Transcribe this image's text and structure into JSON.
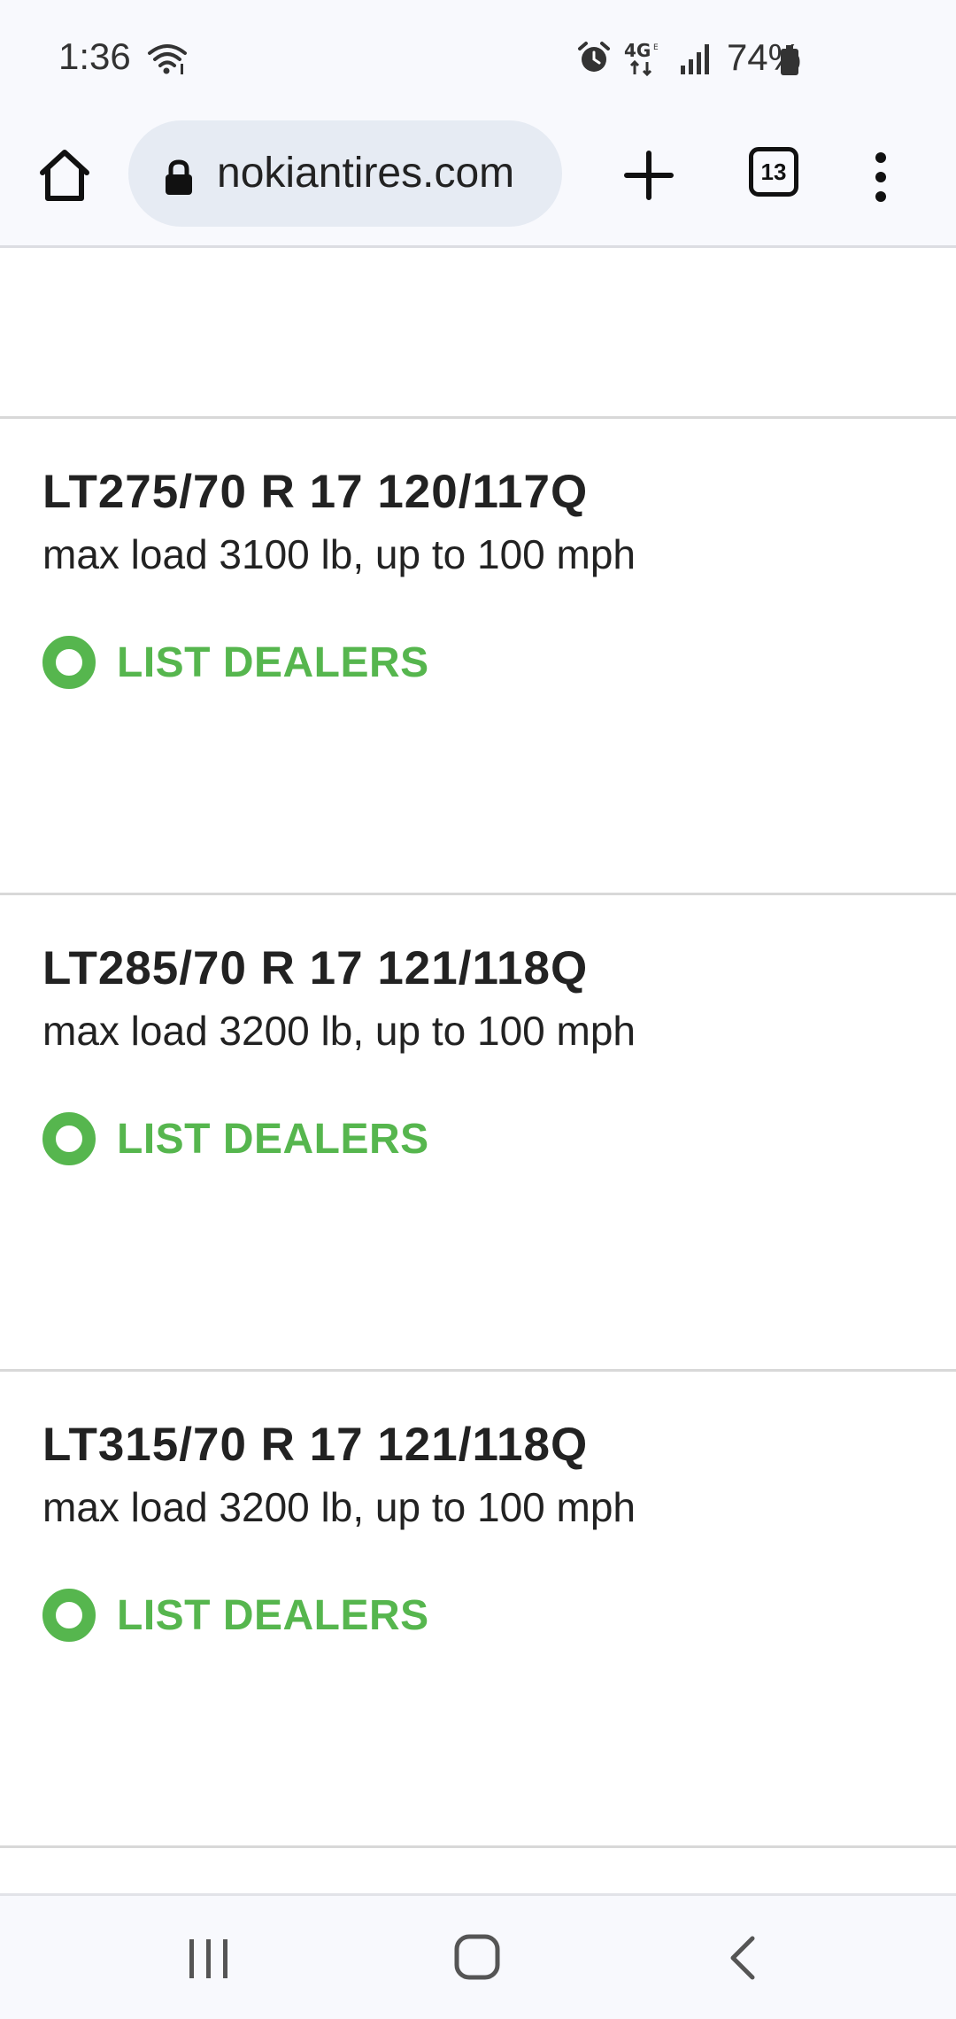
{
  "status_bar": {
    "time": "1:36",
    "battery_percent": "74%",
    "icons": [
      "wifi-icon",
      "alarm-icon",
      "4g-lte-icon",
      "signal-icon",
      "battery-icon"
    ]
  },
  "browser": {
    "url": "nokiantires.com",
    "tab_count": "13",
    "icons": [
      "home-icon",
      "lock-icon",
      "plus-icon",
      "tabs-icon",
      "more-vertical-icon"
    ]
  },
  "tires": [
    {
      "size": "LT275/70 R 17 120/117Q",
      "spec": "max load 3100 lb, up to 100 mph",
      "action": "LIST DEALERS"
    },
    {
      "size": "LT285/70 R 17 121/118Q",
      "spec": "max load 3200 lb, up to 100 mph",
      "action": "LIST DEALERS"
    },
    {
      "size": "LT315/70 R 17 121/118Q",
      "spec": "max load 3200 lb, up to 100 mph",
      "action": "LIST DEALERS"
    }
  ],
  "colors": {
    "accent_green": "#56b64e",
    "text_dark": "#222222",
    "chrome_bg": "#f8f9fd",
    "url_pill_bg": "#e6ebf3",
    "divider": "#d8d8d8"
  },
  "nav_bar": {
    "icons": [
      "recents-icon",
      "home-nav-icon",
      "back-icon"
    ]
  }
}
